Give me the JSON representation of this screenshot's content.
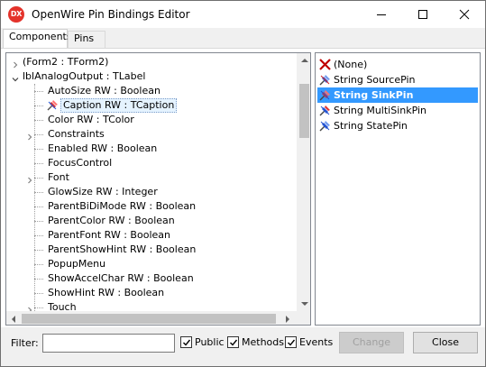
{
  "window": {
    "title": "OpenWire Pin Bindings Editor",
    "app_icon_text": "DX",
    "accent_color": "#3399ff"
  },
  "tabs": [
    {
      "label": "Components",
      "active": true
    },
    {
      "label": "Pins",
      "active": false
    }
  ],
  "tree": {
    "items": [
      {
        "label": "(Form2 : TForm2)",
        "level": 0,
        "expander": "collapsed"
      },
      {
        "label": "lblAnalogOutput : TLabel",
        "level": 0,
        "expander": "expanded"
      },
      {
        "label": "AutoSize RW : Boolean",
        "level": 1,
        "expander": "none"
      },
      {
        "label": "Caption RW : TCaption",
        "level": 1,
        "expander": "none",
        "selected": true,
        "icon": "pin-icon"
      },
      {
        "label": "Color RW : TColor",
        "level": 1,
        "expander": "none"
      },
      {
        "label": "Constraints",
        "level": 1,
        "expander": "collapsed"
      },
      {
        "label": "Enabled RW : Boolean",
        "level": 1,
        "expander": "none"
      },
      {
        "label": "FocusControl",
        "level": 1,
        "expander": "none"
      },
      {
        "label": "Font",
        "level": 1,
        "expander": "collapsed"
      },
      {
        "label": "GlowSize RW : Integer",
        "level": 1,
        "expander": "none"
      },
      {
        "label": "ParentBiDiMode RW : Boolean",
        "level": 1,
        "expander": "none"
      },
      {
        "label": "ParentColor RW : Boolean",
        "level": 1,
        "expander": "none"
      },
      {
        "label": "ParentFont RW : Boolean",
        "level": 1,
        "expander": "none"
      },
      {
        "label": "ParentShowHint RW : Boolean",
        "level": 1,
        "expander": "none"
      },
      {
        "label": "PopupMenu",
        "level": 1,
        "expander": "none"
      },
      {
        "label": "ShowAccelChar RW : Boolean",
        "level": 1,
        "expander": "none"
      },
      {
        "label": "ShowHint RW : Boolean",
        "level": 1,
        "expander": "none"
      },
      {
        "label": "Touch",
        "level": 1,
        "expander": "collapsed"
      }
    ]
  },
  "pins": {
    "items": [
      {
        "label": "(None)",
        "icon": "none-pin-icon",
        "selected": false
      },
      {
        "label": "String SourcePin",
        "icon": "source-pin-icon",
        "selected": false
      },
      {
        "label": "String SinkPin",
        "icon": "sink-pin-icon",
        "selected": true
      },
      {
        "label": "String MultiSinkPin",
        "icon": "multisink-pin-icon",
        "selected": false
      },
      {
        "label": "String StatePin",
        "icon": "state-pin-icon",
        "selected": false
      }
    ]
  },
  "bottom": {
    "filter_label": "Filter:",
    "filter_value": "",
    "checkboxes": [
      {
        "label": "Public",
        "checked": true
      },
      {
        "label": "Methods",
        "checked": true
      },
      {
        "label": "Events",
        "checked": true
      }
    ],
    "change_label": "Change",
    "close_label": "Close"
  }
}
